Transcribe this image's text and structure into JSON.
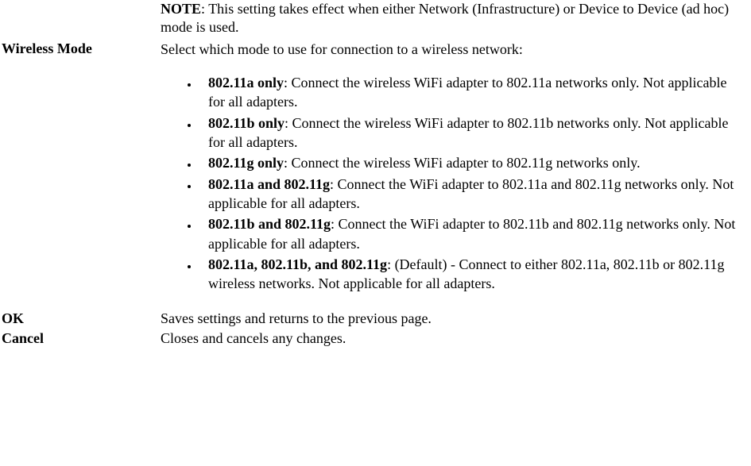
{
  "note": {
    "label": "NOTE",
    "text": ": This setting takes effect when either Network (Infrastructure) or Device to Device (ad hoc) mode is used."
  },
  "wireless_mode": {
    "label": "Wireless Mode",
    "intro": "Select which mode to use for connection to a wireless network:",
    "items": [
      {
        "bold": "802.11a only",
        "text": ": Connect the wireless WiFi adapter to 802.11a networks only. Not applicable for all adapters."
      },
      {
        "bold": "802.11b only",
        "text": ": Connect the wireless WiFi adapter to 802.11b networks only. Not applicable for all adapters."
      },
      {
        "bold": "802.11g only",
        "text": ": Connect the wireless WiFi adapter to 802.11g networks only."
      },
      {
        "bold": "802.11a and 802.11g",
        "text": ": Connect the WiFi adapter to 802.11a and 802.11g networks only. Not applicable for all adapters."
      },
      {
        "bold": "802.11b and 802.11g",
        "text": ": Connect the WiFi adapter to 802.11b and 802.11g networks only. Not applicable for all adapters."
      },
      {
        "bold": "802.11a, 802.11b, and 802.11g",
        "text": ": (Default) - Connect to either 802.11a, 802.11b or 802.11g wireless networks. Not applicable for all adapters."
      }
    ]
  },
  "ok": {
    "label": "OK",
    "text": "Saves settings and returns to the previous page."
  },
  "cancel": {
    "label": "Cancel",
    "text": "Closes and cancels any changes."
  }
}
